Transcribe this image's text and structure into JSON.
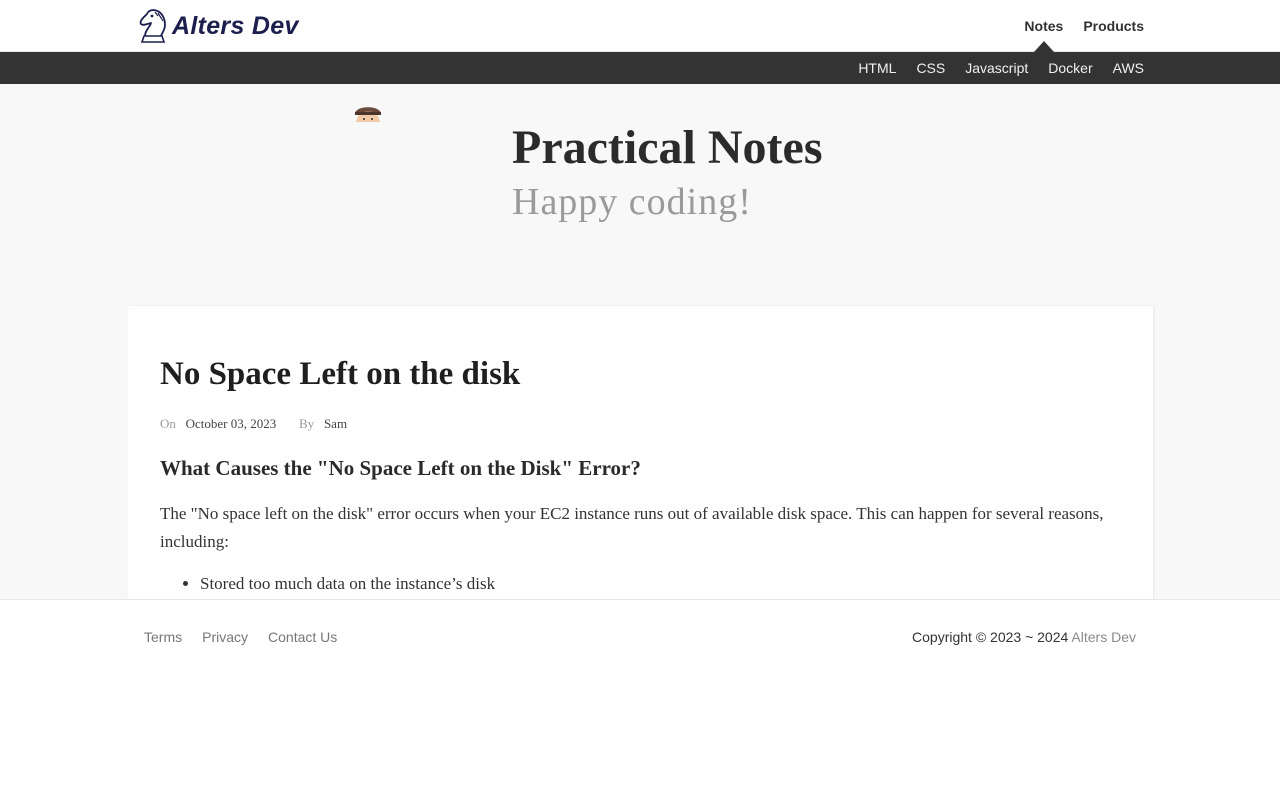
{
  "header": {
    "logo_text": "Alters Dev",
    "nav": [
      {
        "label": "Notes",
        "active": true
      },
      {
        "label": "Products",
        "active": false
      }
    ]
  },
  "subnav": {
    "items": [
      "HTML",
      "CSS",
      "Javascript",
      "Docker",
      "AWS"
    ]
  },
  "hero": {
    "title": "Practical Notes",
    "subtitle": "Happy coding!"
  },
  "article": {
    "title": "No Space Left on the disk",
    "on_label": "On",
    "date": "October 03, 2023",
    "by_label": "By",
    "author": "Sam",
    "heading": "What Causes the \"No Space Left on the Disk\" Error?",
    "paragraph": "The \"No space left on the disk\" error occurs when your EC2 instance runs out of available disk space. This can happen for several reasons, including:",
    "list": [
      "Stored too much data on the instance’s disk"
    ]
  },
  "footer": {
    "links": [
      "Terms",
      "Privacy",
      "Contact Us"
    ],
    "copyright_prefix": "Copyright © 2023 ~ 2024",
    "copyright_brand": "Alters Dev"
  },
  "colors": {
    "subnav_bg": "#333333",
    "hero_bg": "#f8f8f8",
    "logo_color": "#1c1f4e"
  },
  "icons": {
    "logo": "knight-chess-icon",
    "avatar": "avatar-icon"
  }
}
